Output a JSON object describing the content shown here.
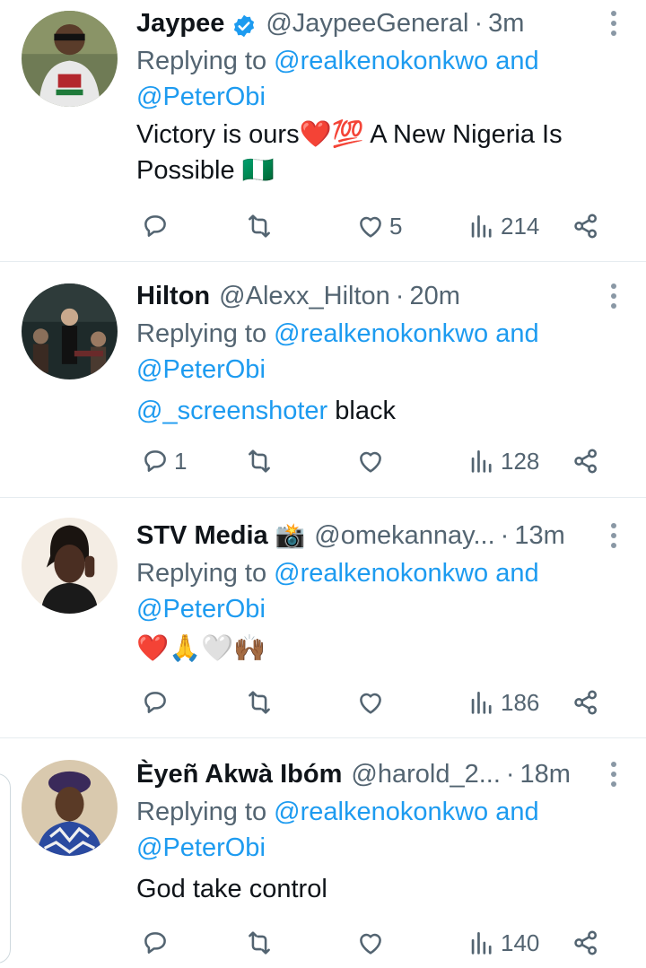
{
  "tweets": [
    {
      "name": "Jaypee",
      "verified": true,
      "handle": "@JaypeeGeneral",
      "time": "3m",
      "reply_prefix": "Replying to",
      "reply_to_1": "@realkenokonkwo",
      "reply_and": "and",
      "reply_to_2": "@PeterObi",
      "text_line1": "Victory is ours❤️💯 A New Nigeria Is",
      "text_line2": "Possible 🇳🇬",
      "replies": "",
      "retweets": "",
      "likes": "5",
      "views": "214"
    },
    {
      "name": "Hilton",
      "handle": "@Alexx_Hilton",
      "time": "20m",
      "reply_prefix": "Replying to",
      "reply_to_1": "@realkenokonkwo",
      "reply_and": "and",
      "reply_to_2": "@PeterObi",
      "text_mention": "@_screenshoter",
      "text": " black",
      "replies": "1",
      "retweets": "",
      "likes": "",
      "views": "128"
    },
    {
      "name": "STV Media",
      "name_emoji": "📸",
      "handle": "@omekannay...",
      "time": "13m",
      "reply_prefix": "Replying to",
      "reply_to_1": "@realkenokonkwo",
      "reply_and": "and",
      "reply_to_2": "@PeterObi",
      "text": "❤️🙏🤍🙌🏾",
      "replies": "",
      "retweets": "",
      "likes": "",
      "views": "186"
    },
    {
      "name": "Èyeñ Akwà Ibóm",
      "handle": "@harold_2...",
      "time": "18m",
      "reply_prefix": "Replying to",
      "reply_to_1": "@realkenokonkwo",
      "reply_and": "and",
      "reply_to_2": "@PeterObi",
      "text": "God take control",
      "replies": "",
      "retweets": "",
      "likes": "",
      "views": "140"
    }
  ],
  "icons": {
    "reply": "speech-bubble-icon",
    "retweet": "retweet-icon",
    "like": "heart-icon",
    "views": "bar-chart-icon",
    "share": "share-icon",
    "menu": "vertical-dots-icon",
    "verified": "verified-badge-icon"
  },
  "colors": {
    "link": "#1d9bf0",
    "muted": "#536471",
    "text": "#0f1419",
    "divider": "#e6ecf0"
  },
  "dot": "·"
}
